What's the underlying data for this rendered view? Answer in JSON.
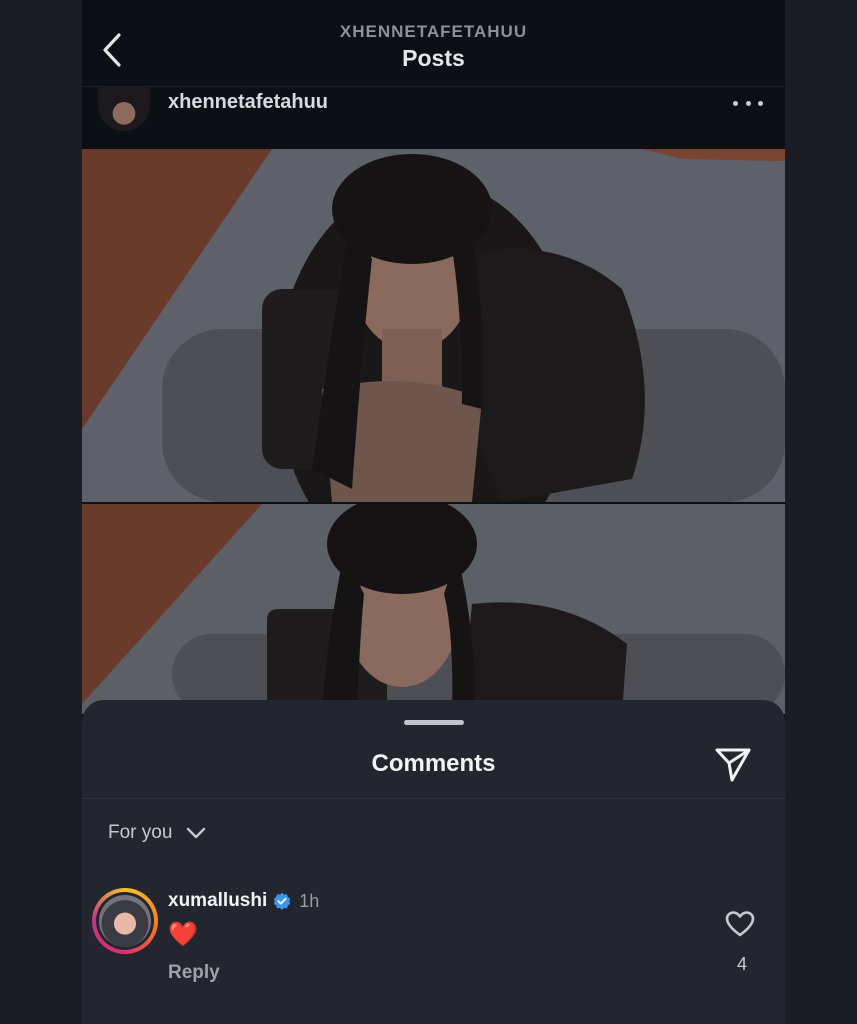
{
  "header": {
    "handle": "XHENNETAFETAHUU",
    "title": "Posts",
    "back_icon": "chevron-left-icon"
  },
  "post": {
    "username": "xhennetafetahuu",
    "more_icon": "more-horizontal-icon"
  },
  "comments_sheet": {
    "title": "Comments",
    "share_icon": "paper-plane-icon",
    "filter_label": "For you",
    "filter_icon": "chevron-down-icon",
    "comments": [
      {
        "username": "xumallushi",
        "verified": true,
        "time": "1h",
        "text": "❤️",
        "reply_label": "Reply",
        "likes": "4"
      }
    ]
  },
  "colors": {
    "background": "#0c0f14",
    "sheet": "#23262e",
    "verified": "#3897f0",
    "heart": "#e3243b"
  }
}
